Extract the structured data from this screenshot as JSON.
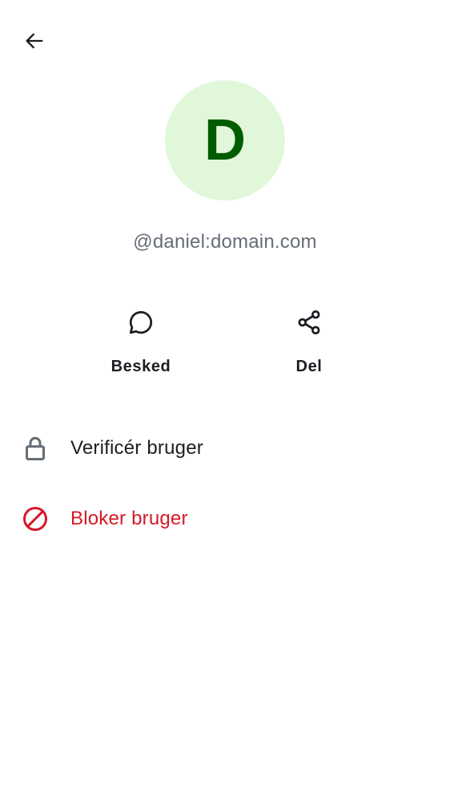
{
  "colors": {
    "avatar_bg": "#e0f8d9",
    "avatar_text": "#005c00",
    "secondary_text": "#656d77",
    "primary_text": "#1b1d22",
    "critical": "#d51928",
    "icon_grey": "#656d77"
  },
  "header": {
    "back_icon": "arrow-left-icon"
  },
  "profile": {
    "avatar_initial": "D",
    "user_id": "@daniel:domain.com"
  },
  "actions": [
    {
      "label": "Besked",
      "icon": "chat-bubble-icon"
    },
    {
      "label": "Del",
      "icon": "share-icon"
    }
  ],
  "menu": {
    "verify": {
      "label": "Verificér bruger",
      "icon": "lock-icon"
    },
    "block": {
      "label": "Bloker bruger",
      "icon": "block-icon"
    }
  }
}
